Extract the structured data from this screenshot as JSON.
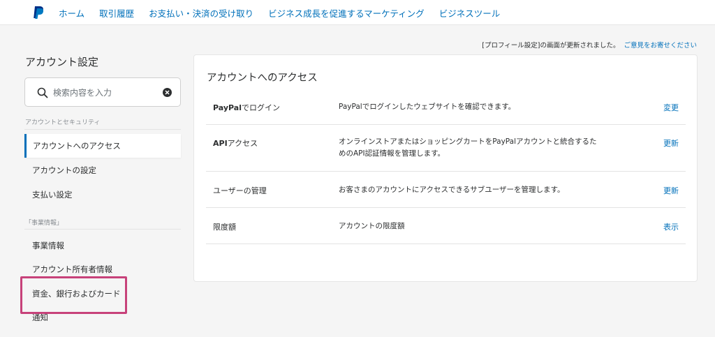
{
  "nav": {
    "items": [
      "ホーム",
      "取引履歴",
      "お支払い・決済の受け取り",
      "ビジネス成長を促進するマーケティング",
      "ビジネスツール"
    ]
  },
  "notice": {
    "text": "[プロフィール設定]の画面が更新されました。",
    "link": "ご意見をお寄せください"
  },
  "sidebar": {
    "title": "アカウント設定",
    "search_placeholder": "検索内容を入力",
    "section1": "アカウントとセキュリティ",
    "items1": [
      "アカウントへのアクセス",
      "アカウントの設定",
      "支払い設定"
    ],
    "section2": "「事業情報」",
    "items2": [
      "事業情報",
      "アカウント所有者情報",
      "資金、銀行およびカード",
      "通知"
    ]
  },
  "main": {
    "title": "アカウントへのアクセス",
    "rows": [
      {
        "label_prefix": "PayPal",
        "label_suffix": "でログイン",
        "desc": "PayPalでログインしたウェブサイトを確認できます。",
        "action": "変更"
      },
      {
        "label_prefix": "API",
        "label_suffix": "アクセス",
        "desc": "オンラインストアまたはショッピングカートをPayPalアカウントと統合するた",
        "desc2": "めのAPI認証情報を管理します。",
        "action": "更新"
      },
      {
        "label": "ユーザーの管理",
        "desc": "お客さまのアカウントにアクセスできるサブユーザーを管理します。",
        "action": "更新"
      },
      {
        "label": "限度額",
        "desc": "アカウントの限度額",
        "action": "表示"
      }
    ]
  },
  "colors": {
    "link": "#0070ba",
    "highlight": "#c7427a"
  }
}
